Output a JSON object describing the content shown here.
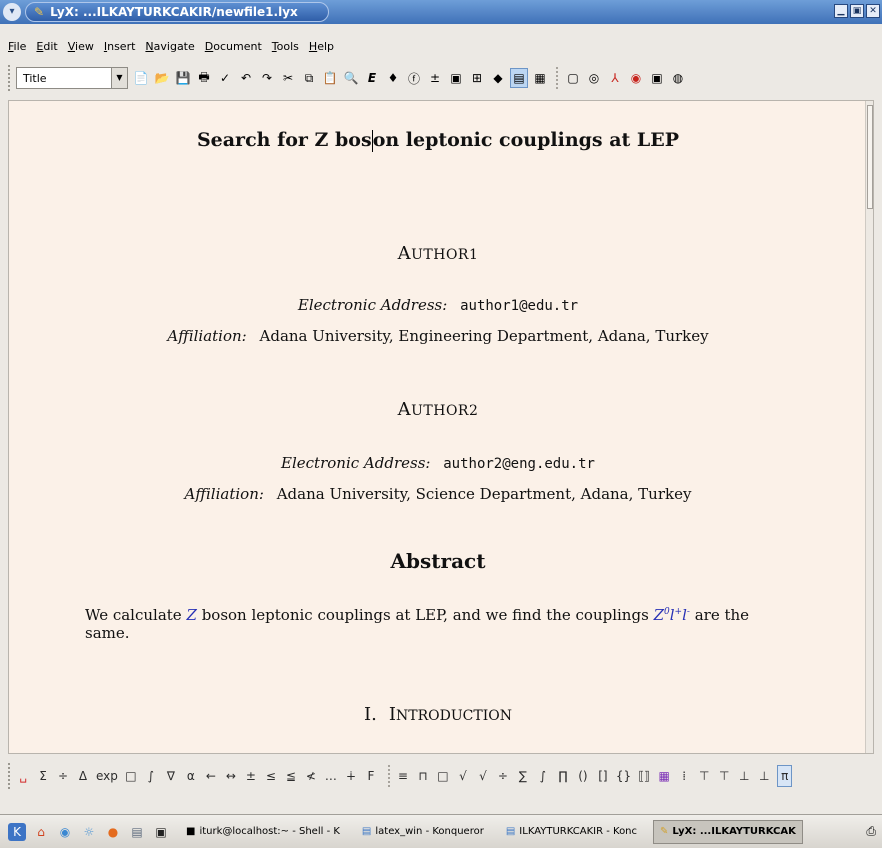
{
  "window": {
    "title": "LyX: ...ILKAYTURKCAKIR/newfile1.lyx",
    "controls": [
      "minimize",
      "maximize",
      "close"
    ]
  },
  "menu": {
    "items": [
      "File",
      "Edit",
      "View",
      "Insert",
      "Navigate",
      "Document",
      "Tools",
      "Help"
    ]
  },
  "toolbar": {
    "layout_value": "Title",
    "icons": [
      "new-icon",
      "open-icon",
      "save-icon",
      "print-icon",
      "spellcheck-icon",
      "undo-icon",
      "redo-icon",
      "cut-icon",
      "copy-icon",
      "paste-icon",
      "find-icon",
      "emphasis-icon",
      "noun-icon",
      "font-icon",
      "math-icon",
      "figure-icon",
      "table-icon",
      "toc-icon",
      "view-source-icon",
      "tabular-icon",
      "dvi-icon",
      "pdf-icon",
      "ps-icon"
    ]
  },
  "document": {
    "title_before_cursor": "Search for Z bos",
    "title_after_cursor": "on leptonic couplings at LEP",
    "authors": [
      {
        "name_first": "A",
        "name_rest": "UTHOR1",
        "email_label": "Electronic Address:",
        "email": "author1@edu.tr",
        "affiliation_label": "Affiliation:",
        "affiliation": "Adana University, Engineering Department, Adana, Turkey"
      },
      {
        "name_first": "A",
        "name_rest": "UTHOR2",
        "email_label": "Electronic Address:",
        "email": "author2@eng.edu.tr",
        "affiliation_label": "Affiliation:",
        "affiliation": "Adana University, Science Department, Adana, Turkey"
      }
    ],
    "abstract_heading": "Abstract",
    "abstract": {
      "part1": "We calculate",
      "math1": "Z",
      "part2": "boson leptonic couplings at LEP, and we find the couplings",
      "math2_base": "Z",
      "math2_sup1": "0",
      "math2_mid": "l",
      "math2_sup2": "+",
      "math2_end": "l",
      "math2_sup3": "-",
      "part3": "are the same."
    },
    "section": {
      "number": "I.",
      "first": "I",
      "rest": "NTRODUCTION"
    }
  },
  "mathbar": {
    "symbols": [
      "␣",
      "Σ",
      "÷",
      "Δ",
      "exp",
      "□",
      "∫",
      "∇",
      "α",
      "←",
      "↔",
      "±",
      "≤",
      "≦",
      "≮",
      "…",
      "∔",
      "F",
      "≡",
      "⊓",
      "□",
      "√",
      "√",
      "÷",
      "∑",
      "∫",
      "∏",
      "()",
      "[]",
      "{}",
      "⟦⟧",
      "▦",
      "⁞",
      "⊤",
      "⊤",
      "⊥",
      "⊥",
      "π"
    ]
  },
  "taskbar": {
    "quicklaunch_icons": [
      "kde-icon",
      "home-icon",
      "browser-icon",
      "network-icon",
      "firefox-icon",
      "document-icon",
      "terminal-icon"
    ],
    "tasks": [
      {
        "label": "iturk@localhost:~ - Shell - K",
        "icon": "terminal-icon",
        "active": false
      },
      {
        "label": "latex_win - Konqueror",
        "icon": "folder-icon",
        "active": false
      },
      {
        "label": "ILKAYTURKCAKIR - Konc",
        "icon": "folder-icon",
        "active": false
      },
      {
        "label": "LyX: ...ILKAYTURKCAK",
        "icon": "lyx-icon",
        "active": true
      }
    ]
  }
}
